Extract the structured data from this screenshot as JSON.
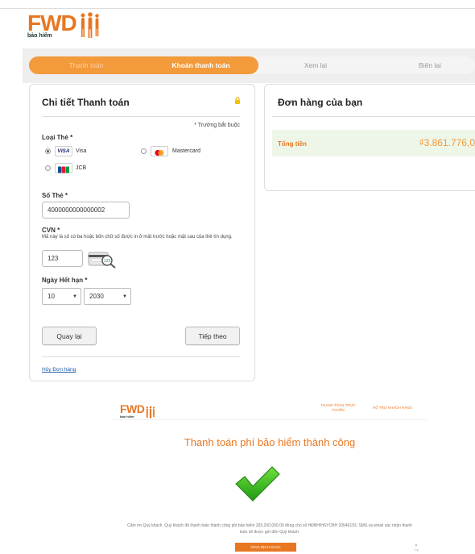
{
  "brand": {
    "logo_text": "FWD",
    "logo_sub": "bảo hiểm",
    "orange": "#e87722",
    "green": "#183028"
  },
  "steps": [
    {
      "label": "Thanh toán",
      "state": "done"
    },
    {
      "label": "Khoản thanh toán",
      "state": "active"
    },
    {
      "label": "Xem lại",
      "state": "pending"
    },
    {
      "label": "Biên lai",
      "state": "pending"
    }
  ],
  "payment": {
    "title": "Chi tiết Thanh toán",
    "lock_icon": "lock-icon",
    "required_note": "* Trường bắt buộc",
    "card_type_label": "Loại Thẻ *",
    "card_types": [
      {
        "name": "Visa",
        "logo": "VISA",
        "selected": true
      },
      {
        "name": "Mastercard",
        "selected": false
      },
      {
        "name": "JCB",
        "logo": "JCB",
        "selected": false
      }
    ],
    "card_number_label": "Số Thẻ *",
    "card_number_value": "4000000000000002",
    "cvn_label": "CVN *",
    "cvn_help": "Mã này là số có ba hoặc bốn chữ số được in ở mặt trước hoặc mặt sau của thẻ tín dụng.",
    "cvn_value": "123",
    "cvn_example": "123",
    "expiry_label": "Ngày Hết hạn *",
    "expiry_month": "10",
    "expiry_year": "2030",
    "back_button": "Quay lại",
    "next_button": "Tiếp theo",
    "cancel_link": "Hủy Đơn hàng"
  },
  "order": {
    "title": "Đơn hàng của bạn",
    "total_label": "Tổng tiền",
    "total_value": "₫3.861.776,0"
  },
  "confirmation": {
    "nav_online": "THANH TOÁN TRỰC TUYẾN",
    "nav_support": "HỖ TRỢ KHÁCH HÀNG",
    "title": "Thanh toán phí bảo hiểm thành công",
    "message_line1": "Cảm ơn Quý khách. Quý khách đã thanh toán thành công phí bảo hiểm 265,200,000.00 đồng cho số HĐBH/HSYCBH 20546193. SMS và email xác nhận thanh",
    "message_line2": "toán sẽ được gửi đến Quý khách.",
    "button": "GIAO DỊCH KHÁC",
    "top_label": "Top"
  }
}
